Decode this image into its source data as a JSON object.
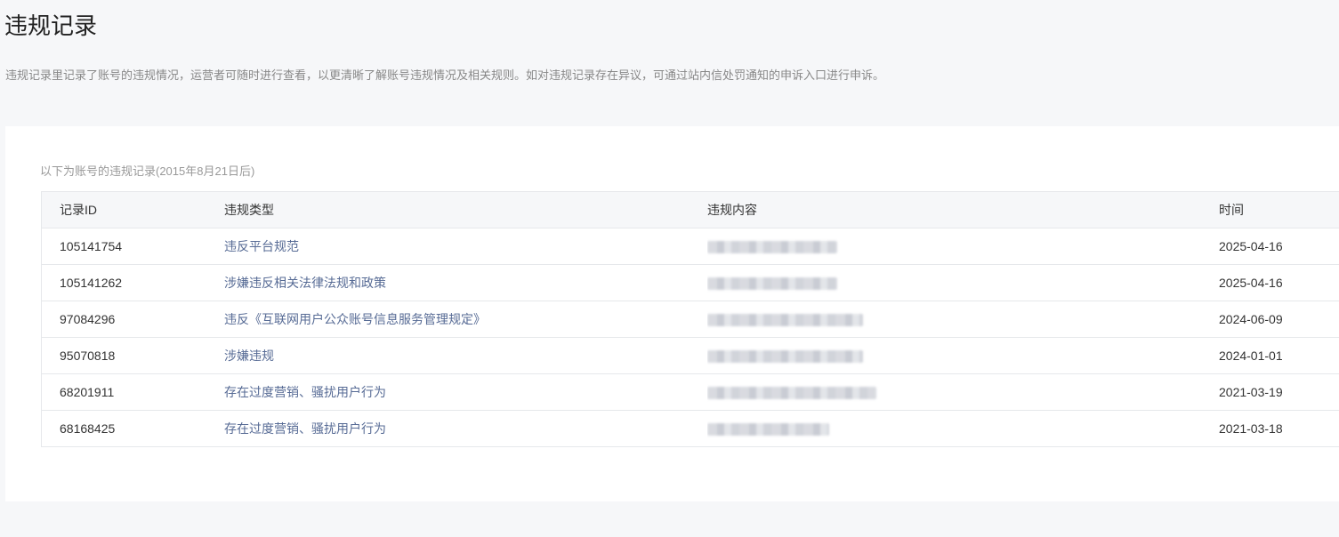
{
  "page": {
    "title": "违规记录",
    "description": "违规记录里记录了账号的违规情况，运营者可随时进行查看，以更清晰了解账号违规情况及相关规则。如对违规记录存在异议，可通过站内信处罚通知的申诉入口进行申诉。"
  },
  "records": {
    "caption": "以下为账号的违规记录(2015年8月21日后)",
    "columns": {
      "id": "记录ID",
      "type": "违规类型",
      "content": "违规内容",
      "time": "时间"
    },
    "rows": [
      {
        "id": "105141754",
        "type": "违反平台规范",
        "content_blur_width": 0.5,
        "time": "2025-04-16"
      },
      {
        "id": "105141262",
        "type": "涉嫌违反相关法律法规和政策",
        "content_blur_width": 0.5,
        "time": "2025-04-16"
      },
      {
        "id": "97084296",
        "type": "违反《互联网用户公众账号信息服务管理规定》",
        "content_blur_width": 0.6,
        "time": "2024-06-09"
      },
      {
        "id": "95070818",
        "type": "涉嫌违规",
        "content_blur_width": 0.6,
        "time": "2024-01-01"
      },
      {
        "id": "68201911",
        "type": "存在过度营销、骚扰用户行为",
        "content_blur_width": 0.65,
        "time": "2021-03-19"
      },
      {
        "id": "68168425",
        "type": "存在过度营销、骚扰用户行为",
        "content_blur_width": 0.47,
        "time": "2021-03-18"
      }
    ]
  },
  "colors": {
    "background": "#f6f7f9",
    "link": "#576b95",
    "border": "#e6e8eb"
  }
}
